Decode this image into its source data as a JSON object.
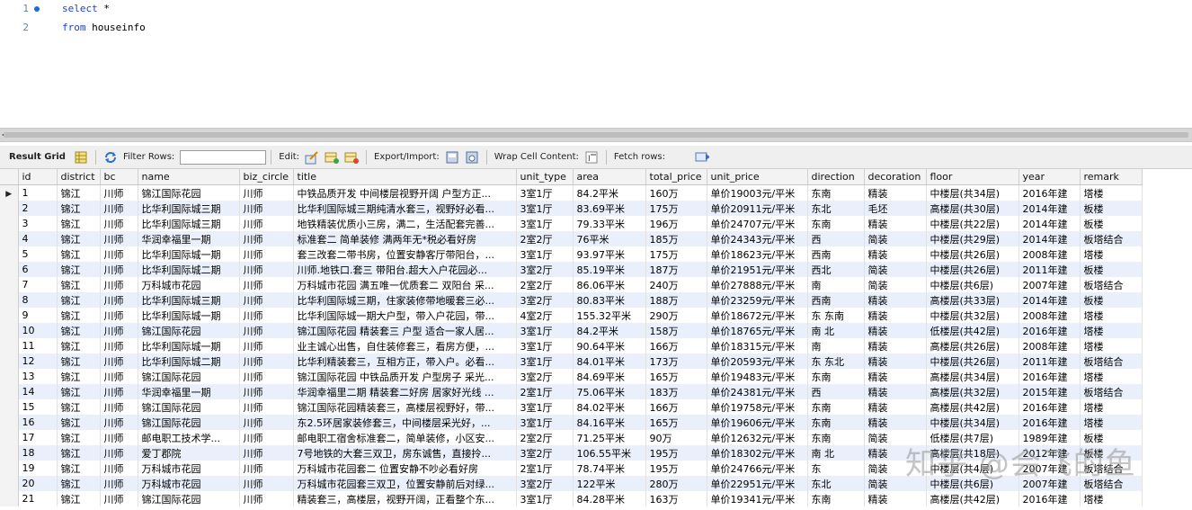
{
  "editor": {
    "lines": [
      {
        "num": "1",
        "keyword": "select",
        "rest": " *"
      },
      {
        "num": "2",
        "keyword": "from",
        "rest": " houseinfo"
      }
    ]
  },
  "toolbar": {
    "result_grid": "Result Grid",
    "filter_rows": "Filter Rows:",
    "filter_value": "",
    "edit": "Edit:",
    "export_import": "Export/Import:",
    "wrap_cell": "Wrap Cell Content:",
    "fetch_rows": "Fetch rows:"
  },
  "grid": {
    "columns": [
      "id",
      "district",
      "bc",
      "name",
      "biz_circle",
      "title",
      "unit_type",
      "area",
      "total_price",
      "unit_price",
      "direction",
      "decoration",
      "floor",
      "year",
      "remark"
    ],
    "rows": [
      [
        "1",
        "锦江",
        "川师",
        "锦江国际花园",
        "川师",
        "中铁品质开发 中间楼层视野开阔 户型方正...",
        "3室1厅",
        "84.2平米",
        "160万",
        "单价19003元/平米",
        "东南",
        "精装",
        "中楼层(共34层)",
        "2016年建",
        "塔楼"
      ],
      [
        "2",
        "锦江",
        "川师",
        "比华利国际城三期",
        "川师",
        "比华利国际城三期纯清水套三，视野好必看...",
        "3室1厅",
        "83.69平米",
        "175万",
        "单价20911元/平米",
        "东北",
        "毛坯",
        "高楼层(共30层)",
        "2014年建",
        "板楼"
      ],
      [
        "3",
        "锦江",
        "川师",
        "比华利国际城三期",
        "川师",
        "地铁精装优质小三房，满二，生活配套完善...",
        "3室1厅",
        "79.33平米",
        "196万",
        "单价24707元/平米",
        "东南",
        "精装",
        "中楼层(共22层)",
        "2014年建",
        "板楼"
      ],
      [
        "4",
        "锦江",
        "川师",
        "华润幸福里一期",
        "川师",
        "标准套二 简单装修 满两年无*税必看好房",
        "2室2厅",
        "76平米",
        "185万",
        "单价24343元/平米",
        "西",
        "简装",
        "中楼层(共29层)",
        "2014年建",
        "板塔结合"
      ],
      [
        "5",
        "锦江",
        "川师",
        "比华利国际城一期",
        "川师",
        "套三改套二带书房，位置安静客厅带阳台，...",
        "3室1厅",
        "93.97平米",
        "175万",
        "单价18623元/平米",
        "西南",
        "精装",
        "中楼层(共26层)",
        "2008年建",
        "塔楼"
      ],
      [
        "6",
        "锦江",
        "川师",
        "比华利国际城二期",
        "川师",
        "川师.地铁口.套三 带阳台.超大入户花园必...",
        "3室2厅",
        "85.19平米",
        "187万",
        "单价21951元/平米",
        "西北",
        "简装",
        "中楼层(共26层)",
        "2011年建",
        "板楼"
      ],
      [
        "7",
        "锦江",
        "川师",
        "万科城市花园",
        "川师",
        "万科城市花园 满五唯一优质套二 双阳台 采...",
        "2室2厅",
        "86.06平米",
        "240万",
        "单价27888元/平米",
        "南",
        "简装",
        "中楼层(共6层)",
        "2007年建",
        "板塔结合"
      ],
      [
        "8",
        "锦江",
        "川师",
        "比华利国际城三期",
        "川师",
        "比华利国际城三期，住家装修带地暖套三必...",
        "3室2厅",
        "80.83平米",
        "188万",
        "单价23259元/平米",
        "西南",
        "精装",
        "高楼层(共33层)",
        "2014年建",
        "板楼"
      ],
      [
        "9",
        "锦江",
        "川师",
        "比华利国际城一期",
        "川师",
        "比华利国际城一期大户型，带入户花园，带...",
        "4室2厅",
        "155.32平米",
        "290万",
        "单价18672元/平米",
        "东 东南",
        "精装",
        "中楼层(共32层)",
        "2008年建",
        "塔楼"
      ],
      [
        "10",
        "锦江",
        "川师",
        "锦江国际花园",
        "川师",
        "锦江国际花园 精装套三 户型 适合一家人居...",
        "3室1厅",
        "84.2平米",
        "158万",
        "单价18765元/平米",
        "南 北",
        "精装",
        "低楼层(共42层)",
        "2016年建",
        "塔楼"
      ],
      [
        "11",
        "锦江",
        "川师",
        "比华利国际城一期",
        "川师",
        "业主诚心出售，自住装修套三，看房方便，...",
        "3室1厅",
        "90.64平米",
        "166万",
        "单价18315元/平米",
        "南",
        "精装",
        "高楼层(共26层)",
        "2008年建",
        "塔楼"
      ],
      [
        "12",
        "锦江",
        "川师",
        "比华利国际城二期",
        "川师",
        "比华利精装套三，互相方正，带入户。必看...",
        "3室1厅",
        "84.01平米",
        "173万",
        "单价20593元/平米",
        "东 东北",
        "精装",
        "中楼层(共26层)",
        "2011年建",
        "板塔结合"
      ],
      [
        "13",
        "锦江",
        "川师",
        "锦江国际花园",
        "川师",
        "锦江国际花园 中铁品质开发 户型房子 采光...",
        "3室2厅",
        "84.69平米",
        "165万",
        "单价19483元/平米",
        "东南",
        "精装",
        "高楼层(共34层)",
        "2016年建",
        "塔楼"
      ],
      [
        "14",
        "锦江",
        "川师",
        "华润幸福里一期",
        "川师",
        "华润幸福里二期 精装套二好房 居家好光线 ...",
        "2室1厅",
        "75.06平米",
        "183万",
        "单价24381元/平米",
        "西",
        "精装",
        "高楼层(共32层)",
        "2015年建",
        "板塔结合"
      ],
      [
        "15",
        "锦江",
        "川师",
        "锦江国际花园",
        "川师",
        "锦江国际花园精装套三，高楼层视野好，带...",
        "3室1厅",
        "84.02平米",
        "166万",
        "单价19758元/平米",
        "东南",
        "精装",
        "高楼层(共42层)",
        "2016年建",
        "塔楼"
      ],
      [
        "16",
        "锦江",
        "川师",
        "锦江国际花园",
        "川师",
        "东2.5环居家装修套三，中间楼层采光好，...",
        "3室1厅",
        "84.16平米",
        "165万",
        "单价19606元/平米",
        "东南",
        "精装",
        "中楼层(共34层)",
        "2016年建",
        "塔楼"
      ],
      [
        "17",
        "锦江",
        "川师",
        "邮电职工技术学...",
        "川师",
        "邮电职工宿舍标准套二，简单装修，小区安...",
        "2室2厅",
        "71.25平米",
        "90万",
        "单价12632元/平米",
        "东南",
        "简装",
        "低楼层(共7层)",
        "1989年建",
        "板楼"
      ],
      [
        "18",
        "锦江",
        "川师",
        "爱丁郡院",
        "川师",
        "7号地铁的大套三双卫，房东诚售，直接拎...",
        "3室2厅",
        "106.55平米",
        "195万",
        "单价18302元/平米",
        "南 北",
        "精装",
        "高楼层(共18层)",
        "2012年建",
        "板楼"
      ],
      [
        "19",
        "锦江",
        "川师",
        "万科城市花园",
        "川师",
        "万科城市花园套二 位置安静不吵必看好房",
        "2室1厅",
        "78.74平米",
        "195万",
        "单价24766元/平米",
        "东",
        "简装",
        "中楼层(共4层)",
        "2007年建",
        "板塔结合"
      ],
      [
        "20",
        "锦江",
        "川师",
        "万科城市花园",
        "川师",
        "万科城市花园套三双卫，位置安静前后对绿...",
        "3室2厅",
        "122平米",
        "280万",
        "单价22951元/平米",
        "东北",
        "简装",
        "中楼层(共6层)",
        "2007年建",
        "板塔结合"
      ],
      [
        "21",
        "锦江",
        "川师",
        "锦江国际花园",
        "川师",
        "精装套三，高楼层，视野开阔，正看整个东...",
        "3室1厅",
        "84.28平米",
        "163万",
        "单价19341元/平米",
        "东南",
        "精装",
        "高楼层(共42层)",
        "2016年建",
        "塔楼"
      ]
    ]
  },
  "watermark": "知乎 @会飞的鱼"
}
